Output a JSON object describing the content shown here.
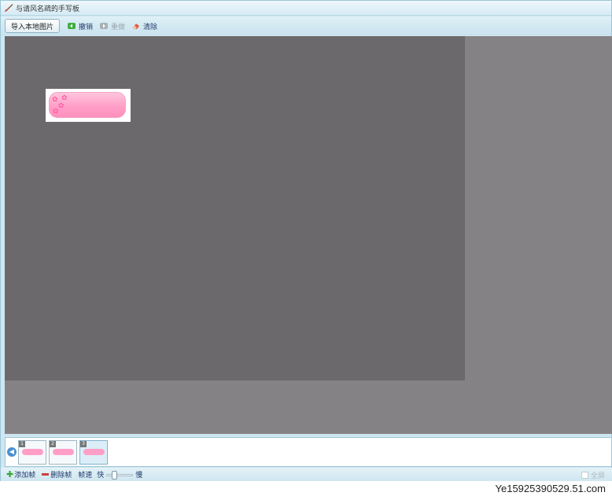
{
  "window": {
    "title": "与请风名疏的手写板"
  },
  "toolbar": {
    "import_label": "导入本地图片",
    "undo_label": "撤销",
    "redo_label": "重做",
    "clear_label": "清除"
  },
  "filmstrip": {
    "frames": [
      {
        "number": "1"
      },
      {
        "number": "2"
      },
      {
        "number": "3"
      }
    ]
  },
  "bottombar": {
    "add_frame_label": "添加帧",
    "delete_frame_label": "删除帧",
    "speed_label": "帧速",
    "fast_label": "快",
    "slow_label": "慢",
    "speed_value": 0.25,
    "fullscreen_label": "全屏"
  },
  "watermark": {
    "text": "Ye15925390529.51.com"
  },
  "colors": {
    "canvas": "#6c696d",
    "stage": "#858286",
    "sticker_pink": "#ff9fc7"
  }
}
